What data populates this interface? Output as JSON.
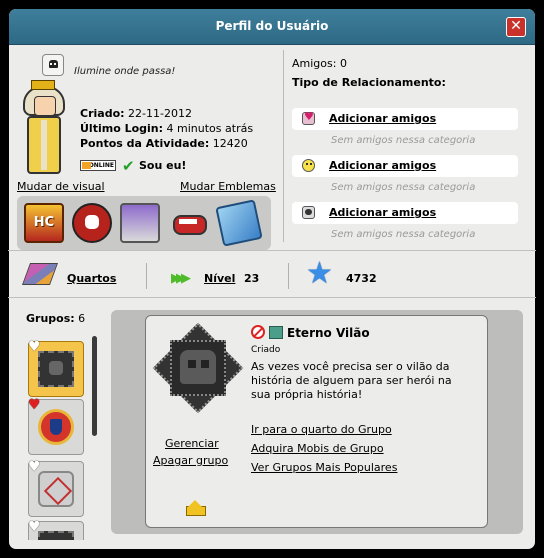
{
  "window": {
    "title": "Perfil do Usuário",
    "close_label": "✕"
  },
  "profile": {
    "motto": "Ilumine onde passa!",
    "created_label": "Criado:",
    "created_value": "22-11-2012",
    "last_login_label": "Último Login:",
    "last_login_value": "4 minutos atrás",
    "activity_label": "Pontos da Atividade:",
    "activity_value": "12420",
    "online_badge": "ONLINE",
    "its_me": "Sou eu!",
    "change_look": "Mudar de visual",
    "change_badges": "Mudar Emblemas",
    "badges": [
      {
        "icon": "hc-badge-icon",
        "text": "HC"
      },
      {
        "icon": "skull-badge-icon"
      },
      {
        "icon": "shopping-cart-badge-icon"
      },
      {
        "icon": "mouth-badge-icon"
      },
      {
        "icon": "ticket-badge-icon"
      }
    ]
  },
  "relationships": {
    "friends_label": "Amigos:",
    "friends_count": "0",
    "type_label": "Tipo de Relacionamento:",
    "items": [
      {
        "icon": "heart-icon",
        "link": "Adicionar amigos",
        "empty": "Sem amigos nessa categoria"
      },
      {
        "icon": "smile-icon",
        "link": "Adicionar amigos",
        "empty": "Sem amigos nessa categoria"
      },
      {
        "icon": "skull-icon",
        "link": "Adicionar amigos",
        "empty": "Sem amigos nessa categoria"
      }
    ]
  },
  "stats": {
    "rooms_label": "Quartos",
    "level_label": "Nível",
    "level_value": "23",
    "score_value": "4732"
  },
  "groups": {
    "label": "Grupos:",
    "count": "6",
    "selected": {
      "name": "Eterno Vilão",
      "status": "Criado",
      "description": "As vezes você precisa ser o vilão da história de alguem para ser herói na sua própria história!",
      "manage": "Gerenciar",
      "delete": "Apagar grupo",
      "links": [
        "Ir para o quarto do Grupo",
        "Adquira Mobis de Grupo",
        "Ver Grupos Mais Populares"
      ]
    }
  },
  "colors": {
    "titlebar": "#3a7693",
    "close": "#c8322a",
    "accent_star": "#3a8ee6",
    "level_green": "#4ebc2a"
  }
}
